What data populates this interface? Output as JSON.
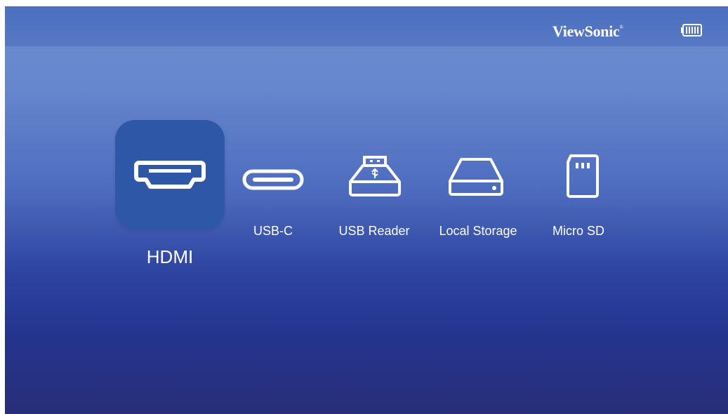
{
  "header": {
    "brand": "ViewSonic",
    "brand_mark": "®",
    "battery_icon": "battery-full-icon"
  },
  "sources": [
    {
      "id": "hdmi",
      "label": "HDMI",
      "icon": "hdmi-port-icon",
      "selected": true
    },
    {
      "id": "usb-c",
      "label": "USB-C",
      "icon": "usb-c-port-icon",
      "selected": false
    },
    {
      "id": "usb-reader",
      "label": "USB Reader",
      "icon": "usb-drive-icon",
      "selected": false
    },
    {
      "id": "local-storage",
      "label": "Local Storage",
      "icon": "hard-drive-icon",
      "selected": false
    },
    {
      "id": "micro-sd",
      "label": "Micro SD",
      "icon": "sd-card-icon",
      "selected": false
    }
  ],
  "colors": {
    "selected_tile": "#2f57a8",
    "text": "#ffffff"
  }
}
